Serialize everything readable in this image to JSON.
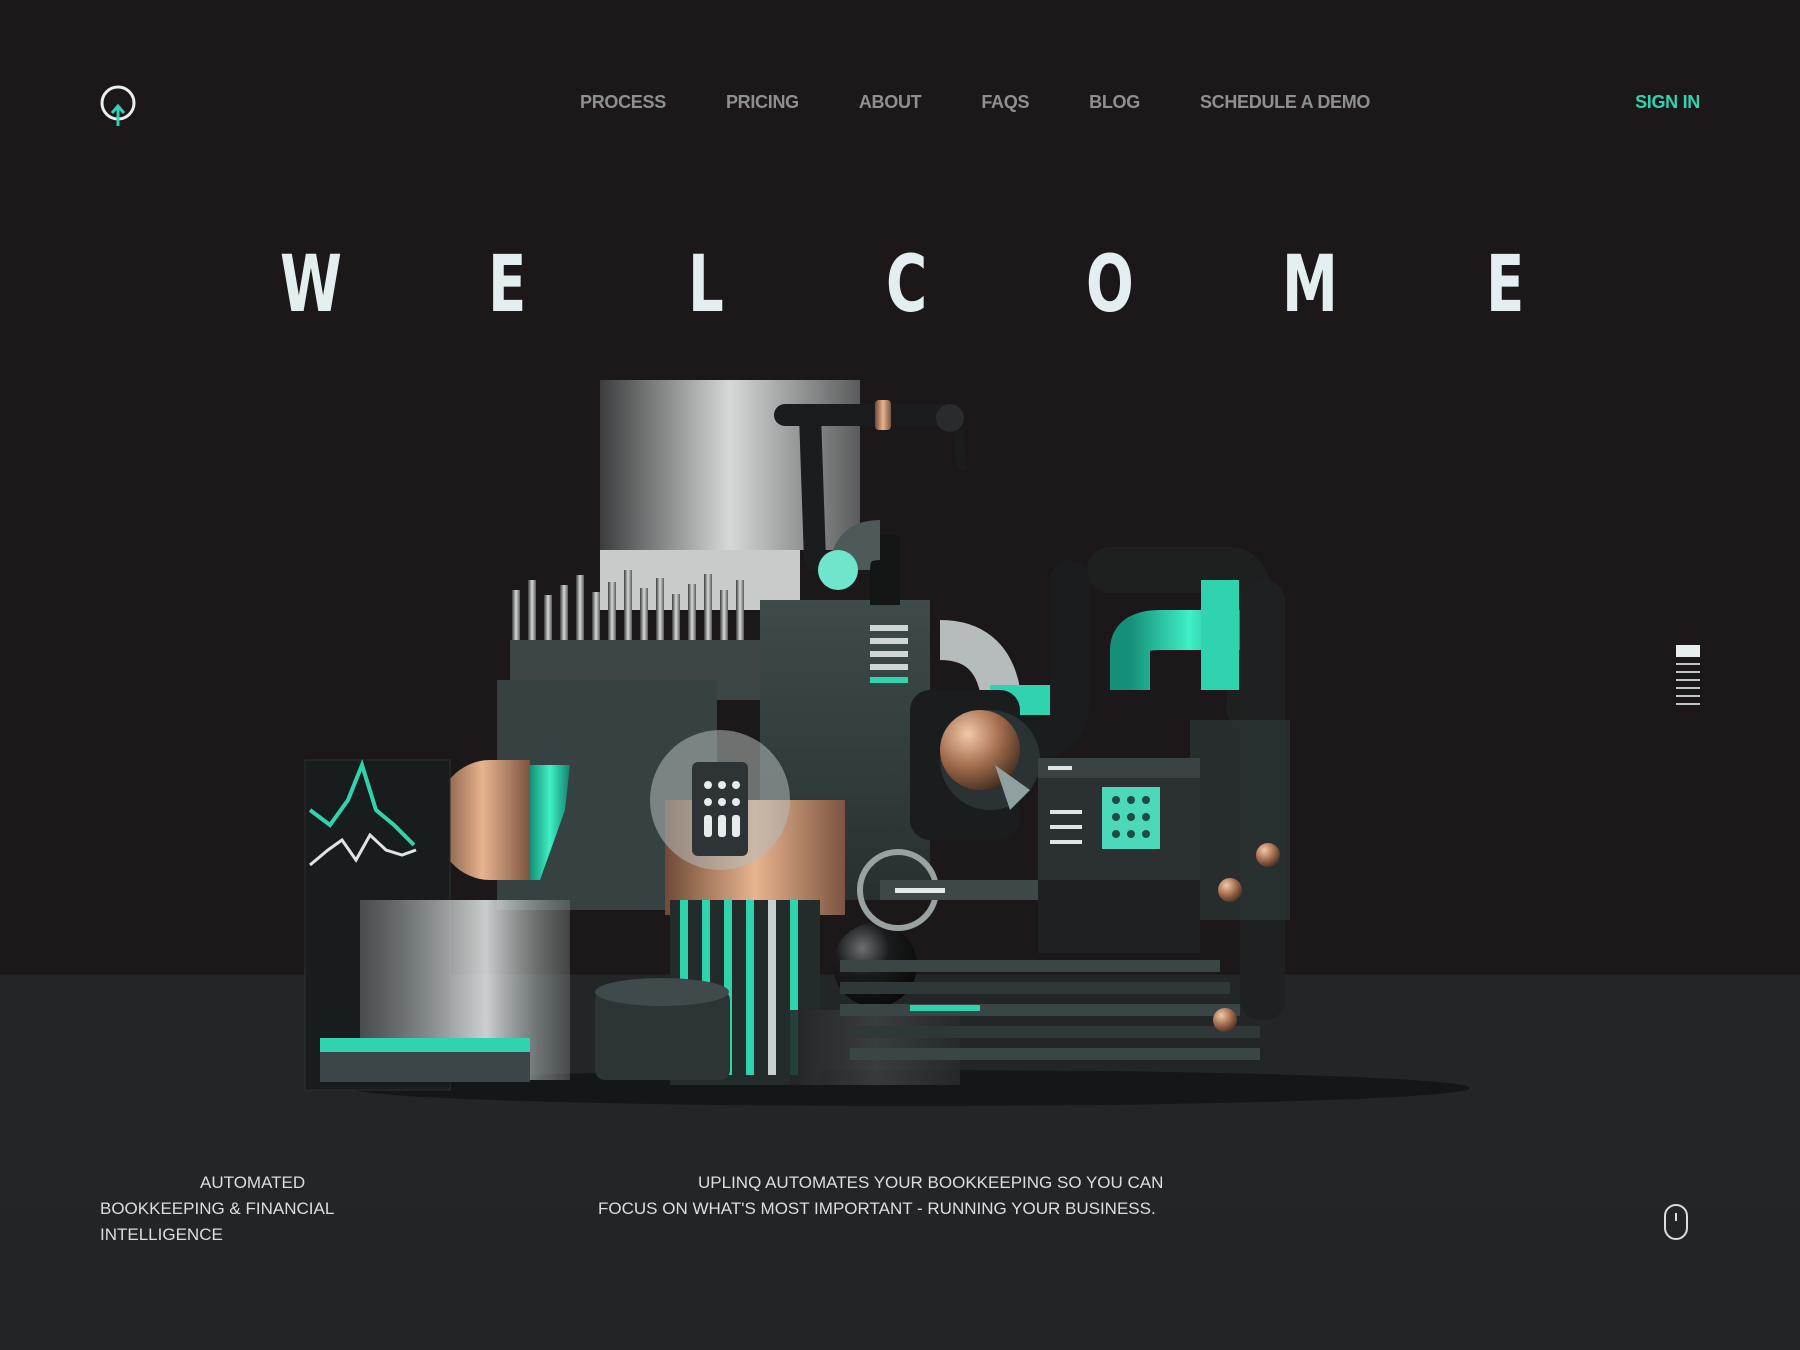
{
  "nav": {
    "items": [
      {
        "label": "PROCESS"
      },
      {
        "label": "PRICING"
      },
      {
        "label": "ABOUT"
      },
      {
        "label": "FAQS"
      },
      {
        "label": "BLOG"
      },
      {
        "label": "SCHEDULE A DEMO"
      }
    ],
    "sign_in": "SIGN IN"
  },
  "hero": {
    "welcome_letters": [
      "W",
      "E",
      "L",
      "C",
      "O",
      "M",
      "E"
    ]
  },
  "captions": {
    "left": {
      "line1": "AUTOMATED",
      "line2": "BOOKKEEPING & FINANCIAL",
      "line3": "INTELLIGENCE"
    },
    "middle": {
      "line1": "UPLINQ AUTOMATES YOUR BOOKKEEPING SO YOU CAN",
      "line2": "FOCUS ON WHAT'S MOST IMPORTANT - RUNNING YOUR BUSINESS."
    }
  },
  "colors": {
    "accent": "#2fd3ae",
    "background_top": "#1c1718",
    "background_bottom": "#222627",
    "nav_text": "#8e9090",
    "headline": "#e2eef0"
  },
  "icons": {
    "logo": "power-pin-logo-icon",
    "scroll_indicator": "section-progress-icon",
    "mouse": "scroll-mouse-icon"
  }
}
